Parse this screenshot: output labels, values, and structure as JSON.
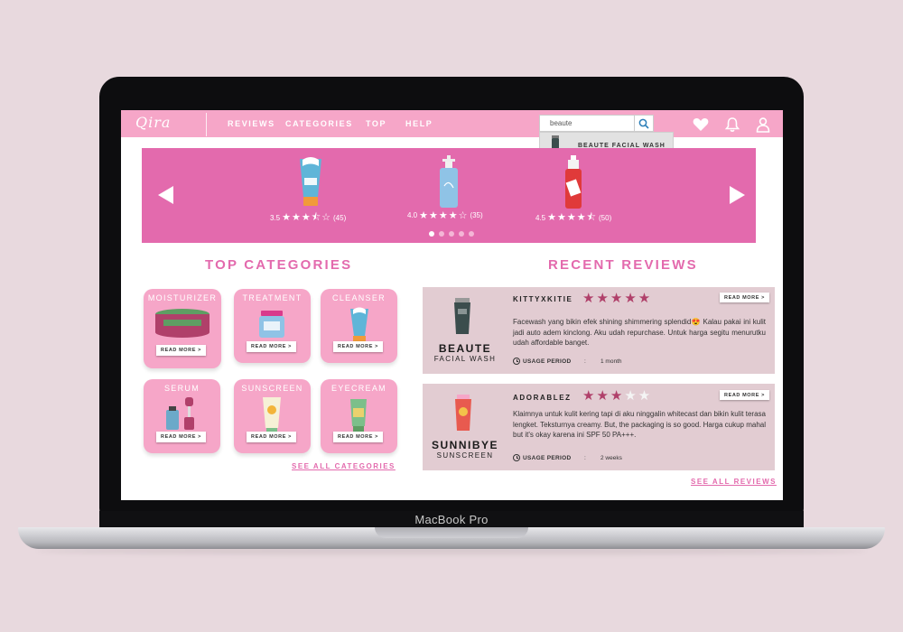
{
  "device": {
    "label": "MacBook Pro"
  },
  "nav": {
    "logo": "Qira",
    "links": [
      "REVIEWS",
      "CATEGORIES",
      "TOP",
      "HELP"
    ],
    "search": {
      "value": "beaute",
      "icon": "search-icon"
    },
    "icons": [
      "heart-icon",
      "bell-icon",
      "user-icon"
    ],
    "suggestion": "BEAUTE FACIAL WASH"
  },
  "banner": {
    "products": [
      {
        "rating": "3.5",
        "stars": "★★★⯪☆",
        "count": "(45)",
        "rating_value": 3.5
      },
      {
        "rating": "4.0",
        "stars": "★★★★☆",
        "count": "(35)",
        "rating_value": 4.0
      },
      {
        "rating": "4.5",
        "stars": "★★★★⯪",
        "count": "(50)",
        "rating_value": 4.5
      }
    ],
    "dots": 5,
    "active_dot": 0
  },
  "categories": {
    "title": "TOP CATEGORIES",
    "items": [
      {
        "name": "MOISTURIZER",
        "readmore": "READ MORE >"
      },
      {
        "name": "TREATMENT",
        "readmore": "READ MORE >"
      },
      {
        "name": "CLEANSER",
        "readmore": "READ MORE >"
      },
      {
        "name": "SERUM",
        "readmore": "READ MORE >"
      },
      {
        "name": "SUNSCREEN",
        "readmore": "READ MORE >"
      },
      {
        "name": "EYECREAM",
        "readmore": "READ MORE >"
      }
    ],
    "see_all": "SEE ALL CATEGORIES"
  },
  "reviews": {
    "title": "RECENT REVIEWS",
    "items": [
      {
        "brand": "BEAUTE",
        "type": "FACIAL WASH",
        "user": "KITTYXKITIE",
        "stars_on": "★★★★★",
        "stars_off": "",
        "stars_value": 5,
        "readmore": "READ MORE >",
        "text": "Facewash yang bikin efek shining shimmering splendid😍 Kalau pakai ini kulit jadi auto adem kinclong. Aku udah repurchase. Untuk harga segitu menurutku udah affordable banget.",
        "usage_label": "USAGE PERIOD",
        "usage_sep": ":",
        "usage_value": "1 month"
      },
      {
        "brand": "SUNNIBYE",
        "type": "SUNSCREEN",
        "user": "ADORABLEZ",
        "stars_on": "★★★",
        "stars_off": "★★",
        "stars_value": 3,
        "readmore": "READ MORE >",
        "text": "Klaimnya untuk kulit kering tapi di aku ninggalin whitecast dan bikin kulit terasa lengket. Teksturnya creamy. But, the packaging is so good. Harga cukup mahal but it's okay karena ini SPF 50 PA+++.",
        "usage_label": "USAGE PERIOD",
        "usage_sep": ":",
        "usage_value": "2 weeks"
      }
    ],
    "see_all": "SEE ALL REVIEWS"
  },
  "colors": {
    "nav": "#f6a6c8",
    "banner": "#e36aad",
    "accent": "#e36aad",
    "star": "#b0406a",
    "review_bg": "#e2ccd2"
  }
}
